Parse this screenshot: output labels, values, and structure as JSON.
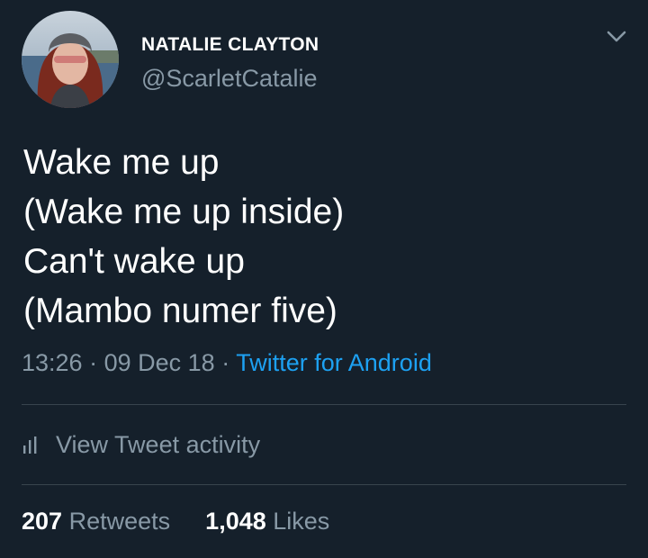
{
  "user": {
    "display_name": "NATALIE CLAYTON",
    "handle": "@ScarletCatalie",
    "avatar_icon": "profile-photo"
  },
  "header": {
    "menu_icon": "chevron-down-icon"
  },
  "tweet": {
    "lines": [
      "Wake me up",
      "(Wake me up inside)",
      "Can't wake up",
      "(Mambo numer five)"
    ],
    "time": "13:26",
    "date": "09 Dec 18",
    "separator": "·",
    "source": "Twitter for Android"
  },
  "activity": {
    "label": "View Tweet activity",
    "icon": "bar-chart-icon"
  },
  "stats": {
    "retweets_count": "207",
    "retweets_label": "Retweets",
    "likes_count": "1,048",
    "likes_label": "Likes"
  },
  "colors": {
    "background": "#15202b",
    "text_primary": "#ffffff",
    "text_secondary": "#8899a6",
    "link": "#1da1f2",
    "divider": "#38444d"
  }
}
